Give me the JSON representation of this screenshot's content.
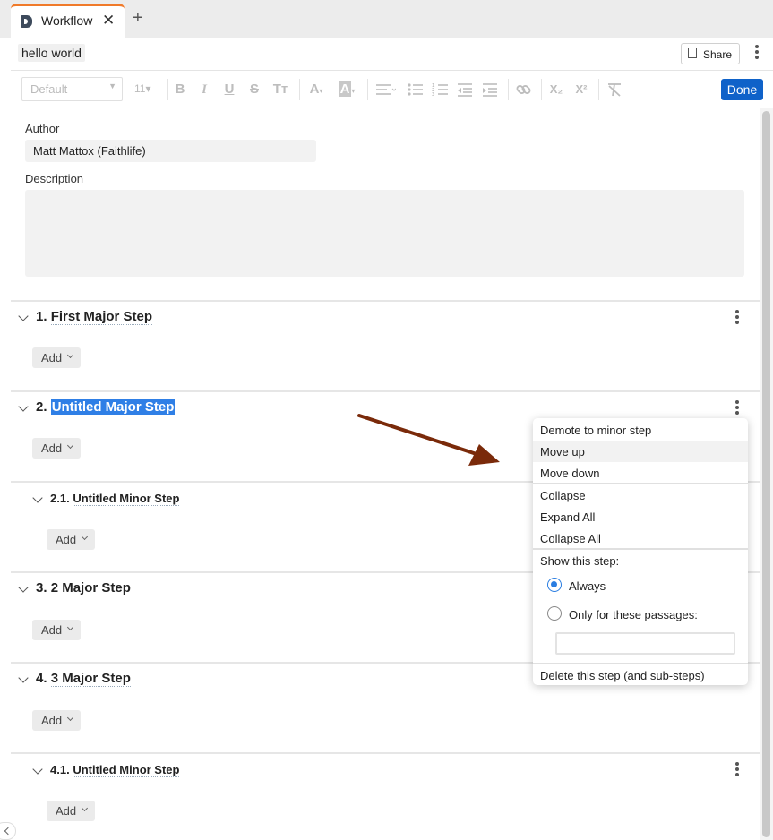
{
  "tab": {
    "label": "Workflow",
    "close": "✕",
    "add": "+"
  },
  "header": {
    "doc_title": "hello world",
    "share_label": "Share"
  },
  "toolbar": {
    "font": "Default",
    "size": "11",
    "bold": "B",
    "italic": "I",
    "underline": "U",
    "strike": "S",
    "text_case": "Tт",
    "font_color": "A",
    "highlight": "A",
    "subscript": "X₂",
    "superscript": "X²",
    "done_label": "Done"
  },
  "meta": {
    "author_label": "Author",
    "author_value": "Matt Mattox (Faithlife)",
    "description_label": "Description",
    "description_value": ""
  },
  "steps": [
    {
      "number": "1.",
      "name": "First Major Step",
      "add": "Add"
    },
    {
      "number": "2.",
      "name": "Untitled Major Step",
      "add": "Add"
    },
    {
      "number": "2.1.",
      "name": "Untitled Minor Step",
      "add": "Add"
    },
    {
      "number": "3.",
      "name": "2 Major Step",
      "add": "Add"
    },
    {
      "number": "4.",
      "name": "3 Major Step",
      "add": "Add"
    },
    {
      "number": "4.1.",
      "name": "Untitled Minor Step",
      "add": "Add"
    }
  ],
  "menu": {
    "demote": "Demote to minor step",
    "move_up": "Move up",
    "move_down": "Move down",
    "collapse": "Collapse",
    "expand_all": "Expand All",
    "collapse_all": "Collapse All",
    "show_label": "Show this step:",
    "always": "Always",
    "only_passages": "Only for these passages:",
    "passages_value": "",
    "delete": "Delete this step (and sub-steps)"
  },
  "colors": {
    "accent": "#0f62c9",
    "tab_accent": "#f07a2a",
    "selection": "#2f7fe6",
    "arrow": "#7a2a0a"
  }
}
